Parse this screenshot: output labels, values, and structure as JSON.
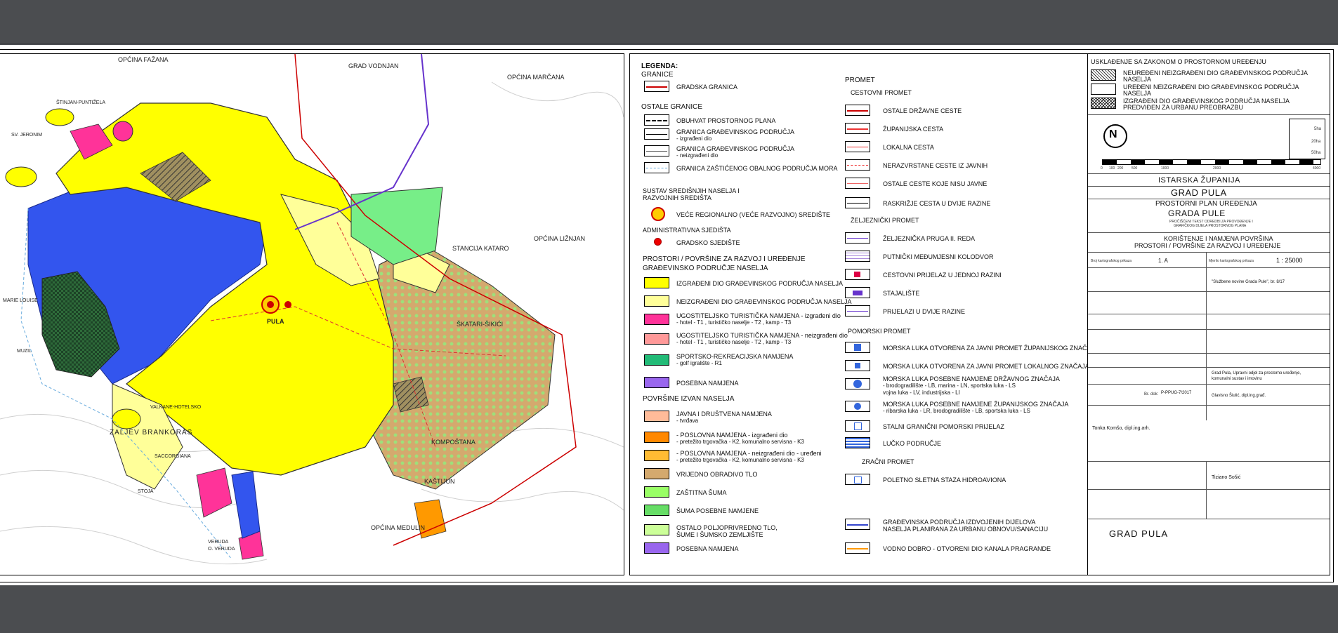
{
  "map": {
    "place_labels": [
      "OPĆINA FAŽANA",
      "GRAD VODNJAN",
      "OPĆINA MARČANA",
      "OPĆINA LIŽNJAN",
      "PULA",
      "STANCIJA KATARO",
      "ŠKATARI-ŠIKIĆI",
      "KOMPOŠTANA",
      "KAŠTIJUN",
      "OPĆINA MEDULIN",
      "ZALJEV BRANKORAS",
      "VALKANE-HOTELSKO",
      "SACCORGIANA",
      "STOJA",
      "VERUDA",
      "O. VERUDA",
      "MUZIL",
      "SV. JERONIM",
      "ŠTINJAN-PUNTIŽELA",
      "MARIE LOUISE"
    ],
    "colors": {
      "built_area": "#ffff00",
      "unbuilt_area": "#ffff99",
      "port_area": "#3355ee",
      "park": "#2e6b3a",
      "farmland": "#d4a96e",
      "forest": "#99ff66",
      "special": "#77ee88",
      "tourism": "#ff3399",
      "border": "#cc0000"
    }
  },
  "legend": {
    "title": "LEGENDA:",
    "granice": "GRANICE",
    "gradska_granica": "GRADSKA GRANICA",
    "ostale_granice": "OSTALE GRANICE",
    "obuhvat": "OBUHVAT PROSTORNOG PLANA",
    "gp_izgradeni_1": "GRANICA GRAĐEVINSKOG PODRUČJA",
    "gp_izgradeni_2": "- izgrađeni dio",
    "gp_neizgradeni_1": "GRANICA GRAĐEVINSKOG PODRUČJA",
    "gp_neizgradeni_2": "- neizgrađeni dio",
    "zop": "GRANICA ZAŠTIĆENOG OBALNOG PODRUČJA MORA",
    "sustav_1": "SUSTAV SREDIŠNJIH NASELJA I",
    "sustav_2": "RAZVOJNIH SREDIŠTA",
    "regionalno": "VEĆE REGIONALNO (VEĆE RAZVOJNO) SREDIŠTE",
    "administrativna": "ADMINISTRATIVNA SJEDIŠTA",
    "gradsko": "GRADSKO SJEDIŠTE",
    "prostori_1": "PROSTORI / POVRŠINE ZA RAZVOJ I UREĐENJE",
    "prostori_2": "GRAĐEVINSKO PODRUČJE NASELJA",
    "izgradeni": "IZGRAĐENI DIO GRAĐEVINSKOG PODRUČJA NASELJA",
    "neizgradeni": "NEIZGRAĐENI DIO GRAĐEVINSKOG PODRUČJA NASELJA",
    "ugost1_1": "UGOSTITELJSKO TURISTIČKA NAMJENA - izgrađeni dio",
    "ugost1_2": "- hotel - T1 , turističko naselje - T2 , kamp - T3",
    "ugost2_1": "UGOSTITELJSKO TURISTIČKA NAMJENA - neizgrađeni dio",
    "ugost2_2": "- hotel - T1 , turističko naselje - T2 , kamp - T3",
    "sport_1": "SPORTSKO-REKREACIJSKA NAMJENA",
    "sport_2": "- golf igralište - R1",
    "posebna": "POSEBNA NAMJENA",
    "izvan": "POVRŠINE IZVAN NASELJA",
    "javna_1": "JAVNA I DRUŠTVENA NAMJENA",
    "javna_2": "- tvrđava",
    "posl1_1": "- POSLOVNA NAMJENA - izgrađeni dio",
    "posl1_2": "- pretežito trgovačka - K2, komunalno servisna - K3",
    "posl2_1": "- POSLOVNA NAMJENA - neizgrađeni dio - uređeni",
    "posl2_2": "- pretežito trgovačka - K2, komunalno servisna - K3",
    "vrijedno": "VRIJEDNO OBRADIVO TLO",
    "zastitna": "ZAŠTITNA ŠUMA",
    "suma_posebne": "ŠUMA POSEBNE NAMJENE",
    "ostalo_1": "OSTALO POLJOPRIVREDNO TLO,",
    "ostalo_2": "ŠUME I ŠUMSKO ZEMLJIŠTE",
    "posebna2": "POSEBNA NAMJENA",
    "promet": "PROMET",
    "cestovni": "CESTOVNI PROMET",
    "drzavne": "OSTALE DRŽAVNE CESTE",
    "zupanijska": "ŽUPANIJSKA CESTA",
    "lokalna": "LOKALNA CESTA",
    "nerazvrstane": "NERAZVRSTANE CESTE IZ JAVNIH",
    "ostale_ceste": "OSTALE CESTE KOJE NISU JAVNE",
    "raskrizje": "RASKRIŽJE CESTA U DVIJE RAZINE",
    "zeljeznicki": "ŽELJEZNIČKI PROMET",
    "pruga": "ŽELJEZNIČKA PRUGA II. REDA",
    "kolodvor": "PUTNIČKI MEĐUMJESNI KOLODVOR",
    "prijelaz": "CESTOVNI PRIJELAZ U JEDNOJ RAZINI",
    "stajaliste": "STAJALIŠTE",
    "prijelazi2": "PRIJELAZI U DVIJE RAZINE",
    "pomorski": "POMORSKI PROMET",
    "luka_zup": "MORSKA LUKA OTVORENA ZA JAVNI PROMET ŽUPANIJSKOG ZNAČAJA",
    "luka_lok": "MORSKA LUKA OTVORENA ZA JAVNI PROMET LOKALNOG ZNAČAJA",
    "luka_dr_1": "MORSKA LUKA POSEBNE NAMJENE DRŽAVNOG ZNAČAJA",
    "luka_dr_2": "- brodogradilište - LB, marina - LN, sportska luka - LS",
    "luka_dr_3": "vojna luka - LV, industrijska - LI",
    "luka_zu_1": "MORSKA LUKA POSEBNE NAMJENE ŽUPANIJSKOG ZNAČAJA",
    "luka_zu_2": "- ribarska luka - LR, brodogradilište - LB, sportska luka - LS",
    "granicni": "STALNI GRANIČNI POMORSKI PRIJELAZ",
    "lucko": "LUČKO PODRUČJE",
    "zracni": "ZRAČNI PROMET",
    "staza": "POLETNO SLETNA STAZA HIDROAVIONA",
    "urbana_1": "GRAĐEVINSKA PODRUČJA IZDVOJENIH DIJELOVA",
    "urbana_2": "NASELJA PLANIRANA ZA URBANU OBNOVU/SANACIJU",
    "vodno": "VODNO DOBRO - OTVORENI DIO KANALA PRAGRANDE"
  },
  "titleblock": {
    "uskladenje": "USKLAĐENJE SA ZAKONOM O PROSTORNOM UREĐENJU",
    "neuredeni_1": "NEUREĐENI NEIZGRAĐENI DIO GRAĐEVINSKOG PODRUČJA",
    "neuredeni_2": "NASELJA",
    "uredeni_1": "UREĐENI NEIZGRAĐENI DIO GRAĐEVINSKOG PODRUČJA",
    "uredeni_2": "NASELJA",
    "izgradeni_1": "IZGRAĐENI DIO GRAĐEVINSKOG PODRUČJA NASELJA",
    "izgradeni_2": "PREDVIĐEN ZA URBANU PREOBRAZBU",
    "scale_5ha": "5ha",
    "scale_20ha": "20ha",
    "scale_50ha": "50ha",
    "scale_ticks": [
      "0",
      "100",
      "200",
      "500",
      "1000",
      "2000",
      "4000"
    ],
    "county": "ISTARSKA ŽUPANIJA",
    "city": "GRAD PULA",
    "plan_1": "PROSTORNI PLAN UREĐENJA",
    "plan_2": "GRADA PULE",
    "plan_sub_1": "PROČIŠĆENI TEKST ODREDBI ZA PROVOĐENJE I",
    "plan_sub_2": "GRAFIČKOG DIJELA PROSTORNOG PLANA",
    "karta_1": "KORIŠTENJE I NAMJENA POVRŠINA",
    "karta_2": "PROSTORI / POVRŠINE ZA RAZVOJ I UREĐENJE",
    "broj_lbl": "Broj kartografskog prikaza",
    "broj_val": "1. A",
    "mjerilo_lbl": "Mjerilo kartografskog prikaza",
    "mjerilo_val": "1 : 25000",
    "glasnik": "\"Službene novine Grada Pule\", br. 8/17",
    "oznaka_lbl": "Br. dok:",
    "oznaka_val": "P-PPUG-7/2017",
    "grad_upr_1": "Grad Pula, Upravni odjel za prostorno uređenje,",
    "grad_upr_2": "komunalni sustav i imovinu",
    "voditelj": "Glavisno Šiulić, dipl.ing.građ.",
    "izradio": "Tonka Komšo, dipl.ing.arh.",
    "ovjera": "Tiziano Sošić",
    "footer": "GRAD PULA"
  }
}
